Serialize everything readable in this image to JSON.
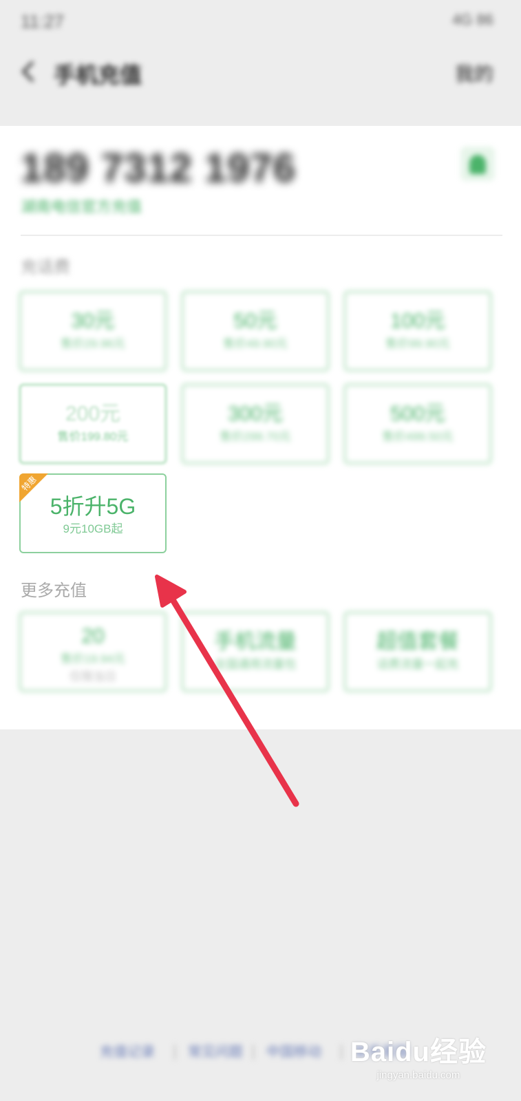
{
  "status_bar": {
    "time": "11:27",
    "icons": "4G 86"
  },
  "nav": {
    "title": "手机充值",
    "right": "我的"
  },
  "account": {
    "phone": "189 7312 1976",
    "carrier_note": "湖南电信官方充值"
  },
  "recharge": {
    "label": "充话费",
    "tiles": [
      {
        "amount": "30元",
        "price": "售价29.96元"
      },
      {
        "amount": "50元",
        "price": "售价49.90元"
      },
      {
        "amount": "100元",
        "price": "售价99.90元"
      },
      {
        "amount": "200元",
        "price": "售价199.80元"
      },
      {
        "amount": "300元",
        "price": "售价299.70元"
      },
      {
        "amount": "500元",
        "price": "售价499.50元"
      }
    ],
    "special": {
      "badge": "特惠",
      "title": "5折升5G",
      "subtitle": "9元10GB起"
    }
  },
  "more": {
    "label": "更多充值",
    "tiles": [
      {
        "amount": "20",
        "price": "售价19.94元",
        "note": "仅限当日"
      },
      {
        "amount": "手机流量",
        "price": "全国通用流量包"
      },
      {
        "amount": "超值套餐",
        "price": "话费流量一起充"
      }
    ]
  },
  "footer": {
    "links": [
      "充值记录",
      "常见问题",
      "中国移动",
      "联系客服"
    ]
  },
  "watermark": {
    "logo": "Baidu经验",
    "url": "jingyan.baidu.com"
  },
  "colors": {
    "accent": "#4bb36a",
    "badge": "#f0a531",
    "arrow": "#e8334a"
  }
}
